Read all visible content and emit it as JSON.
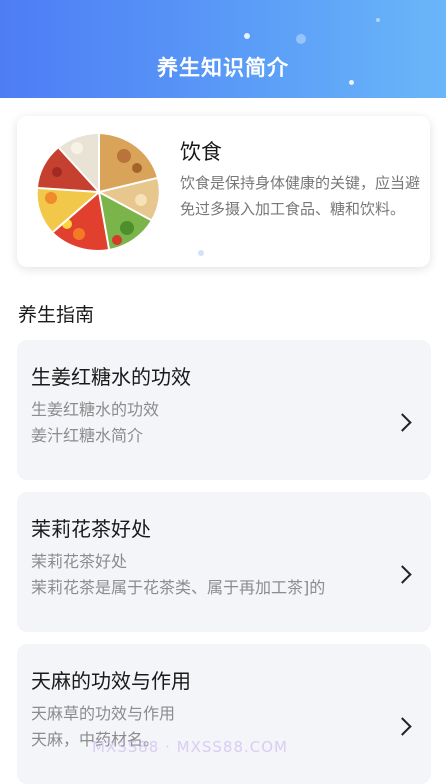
{
  "header": {
    "title": "养生知识简介"
  },
  "feature": {
    "title": "饮食",
    "description": "饮食是保持身体健康的关键，应当避免过多摄入加工食品、糖和饮料。",
    "image": "food-plate-illustration"
  },
  "section": {
    "title": "养生指南"
  },
  "articles": [
    {
      "title": "生姜红糖水的功效",
      "line1": "生姜红糖水的功效",
      "line2": "姜汁红糖水简介"
    },
    {
      "title": "茉莉花茶好处",
      "line1": "茉莉花茶好处",
      "line2": "茉莉花茶是属于花茶类、属于再加工茶]的"
    },
    {
      "title": "天麻的功效与作用",
      "line1": "天麻草的功效与作用",
      "line2": "天麻，中药材名。"
    }
  ],
  "watermark": "MXSS88 · MXSS88.COM",
  "colors": {
    "header_start": "#4e7cf5",
    "header_end": "#6ab6f9",
    "card_bg": "#f4f5f9"
  },
  "icons": {
    "chevron": "chevron-right-icon"
  }
}
